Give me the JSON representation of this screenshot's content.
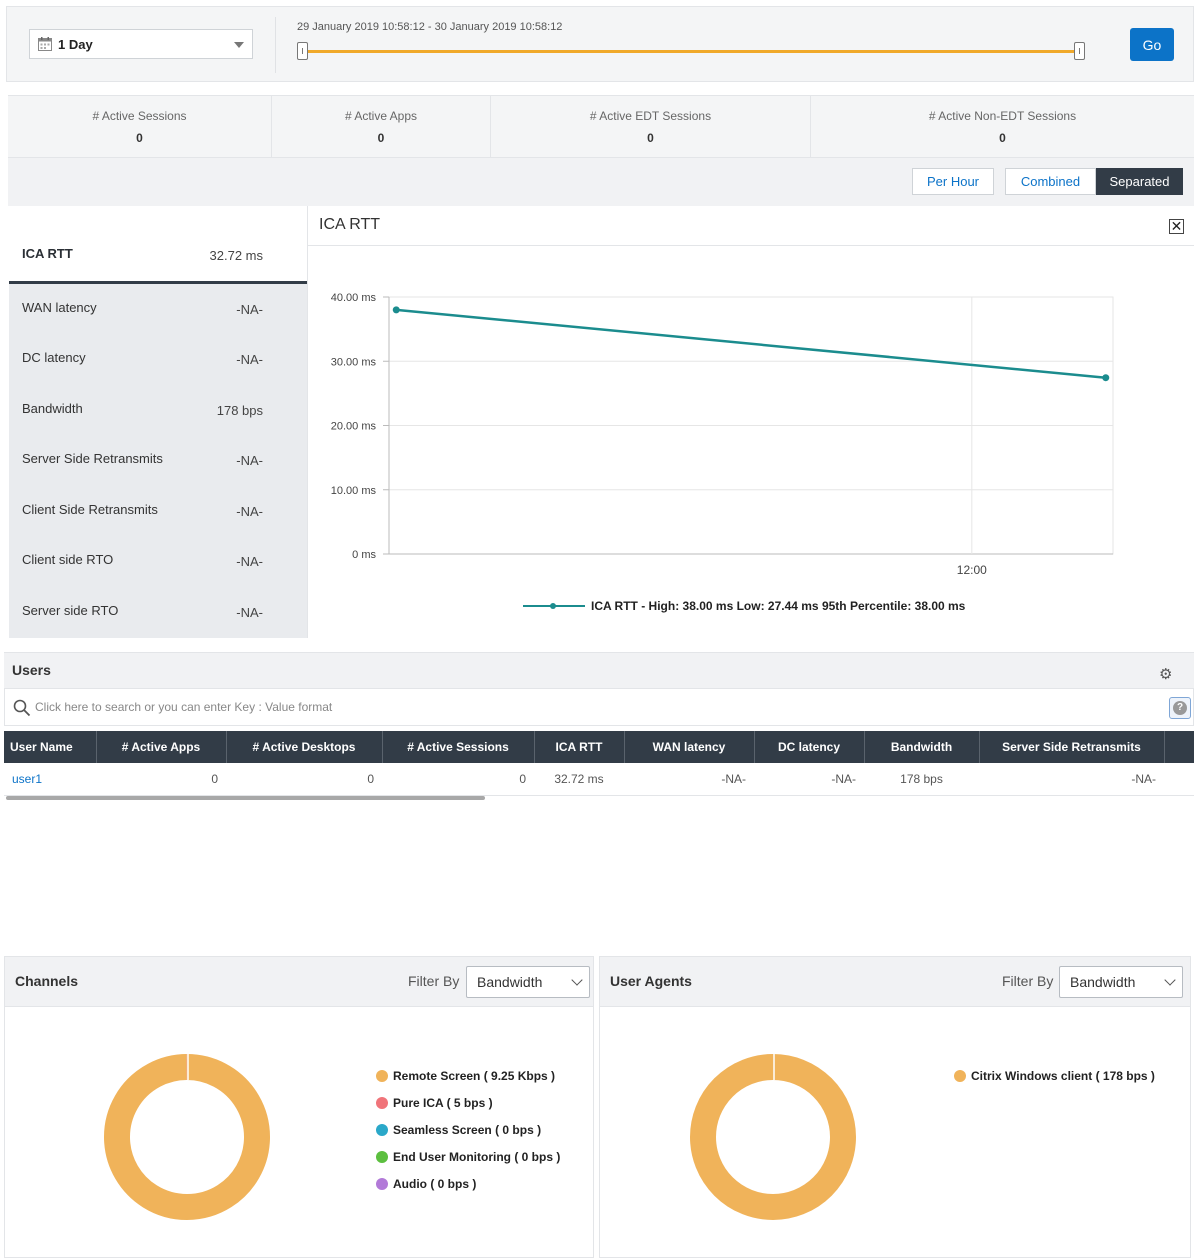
{
  "time_range": {
    "selected": "1 Day",
    "range_text": "29 January 2019 10:58:12 - 30 January 2019 10:58:12",
    "go_label": "Go"
  },
  "stats": [
    {
      "label": "# Active Sessions",
      "value": "0"
    },
    {
      "label": "# Active Apps",
      "value": "0"
    },
    {
      "label": "# Active EDT Sessions",
      "value": "0"
    },
    {
      "label": "# Active Non-EDT Sessions",
      "value": "0"
    }
  ],
  "view_toggle": {
    "per_hour": "Per Hour",
    "combined": "Combined",
    "separated": "Separated",
    "active": "Separated"
  },
  "metrics": [
    {
      "label": "ICA RTT",
      "value": "32.72 ms"
    },
    {
      "label": "WAN latency",
      "value": "-NA-"
    },
    {
      "label": "DC latency",
      "value": "-NA-"
    },
    {
      "label": "Bandwidth",
      "value": "178 bps"
    },
    {
      "label": "Server Side Retransmits",
      "value": "-NA-"
    },
    {
      "label": "Client Side Retransmits",
      "value": "-NA-"
    },
    {
      "label": "Client side RTO",
      "value": "-NA-"
    },
    {
      "label": "Server side RTO",
      "value": "-NA-"
    }
  ],
  "chart_panel": {
    "title": "ICA RTT",
    "close_glyph": "✕"
  },
  "chart_data": {
    "type": "line",
    "title": "ICA RTT",
    "xlabel": "",
    "ylabel": "",
    "x_tick_labels": [
      "12:00"
    ],
    "x_tick_positions_fraction": [
      0.805
    ],
    "y_ticks": [
      0,
      10,
      20,
      30,
      40
    ],
    "y_tick_labels": [
      "0 ms",
      "10.00 ms",
      "20.00 ms",
      "30.00 ms",
      "40.00 ms"
    ],
    "ylim": [
      0,
      40
    ],
    "series": [
      {
        "name": "ICA RTT - High: 38.00 ms Low: 27.44 ms 95th Percentile: 38.00 ms",
        "color": "#1b8c8e",
        "x_fraction": [
          0.01,
          0.99
        ],
        "values": [
          38.0,
          27.44
        ]
      }
    ],
    "grid": true,
    "legend": "bottom"
  },
  "users": {
    "title": "Users",
    "search_placeholder": "Click here to search or you can enter Key : Value format",
    "columns": [
      "User Name",
      "# Active Apps",
      "# Active Desktops",
      "# Active Sessions",
      "ICA RTT",
      "WAN latency",
      "DC latency",
      "Bandwidth",
      "Server Side Retransmits"
    ],
    "rows": [
      [
        "user1",
        "0",
        "0",
        "0",
        "32.72 ms",
        "-NA-",
        "-NA-",
        "178 bps",
        "-NA-"
      ]
    ]
  },
  "channels": {
    "title": "Channels",
    "filter_label": "Filter By",
    "filter_value": "Bandwidth",
    "legend": [
      {
        "label": "Remote Screen ( 9.25 Kbps )",
        "color": "#f0b35a",
        "value": 9250
      },
      {
        "label": "Pure ICA ( 5 bps )",
        "color": "#f0747a",
        "value": 5
      },
      {
        "label": "Seamless Screen ( 0 bps )",
        "color": "#2aa8c9",
        "value": 0
      },
      {
        "label": "End User Monitoring ( 0 bps )",
        "color": "#5cbf3f",
        "value": 0
      },
      {
        "label": "Audio ( 0 bps )",
        "color": "#b27ad8",
        "value": 0
      }
    ]
  },
  "user_agents": {
    "title": "User Agents",
    "filter_label": "Filter By",
    "filter_value": "Bandwidth",
    "legend": [
      {
        "label": "Citrix Windows client ( 178 bps )",
        "color": "#f0b35a",
        "value": 178
      }
    ]
  }
}
